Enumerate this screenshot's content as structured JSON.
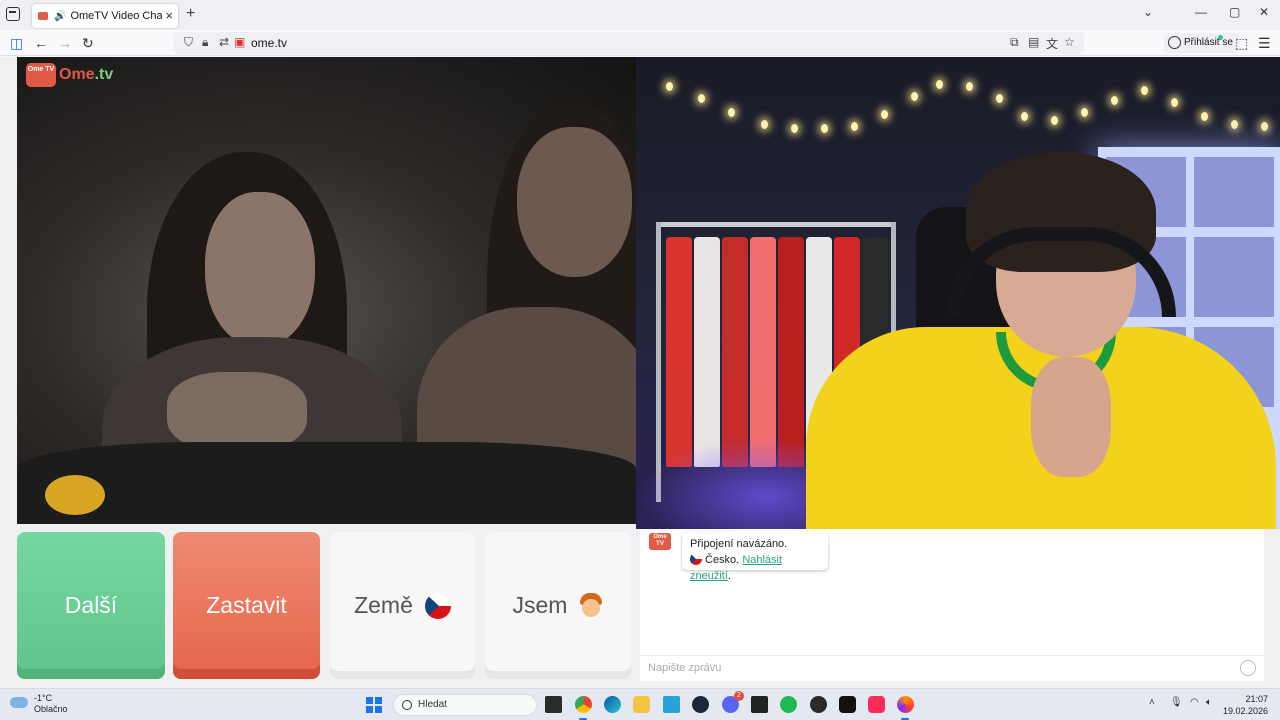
{
  "browser": {
    "tab": {
      "title": "OmeTV Video Chat — Ome",
      "new_tab": "+"
    },
    "window_controls": {
      "chevron": "⌄",
      "minimize": "—",
      "maximize": "▢",
      "close": "✕"
    },
    "url": "ome.tv",
    "signin_label": "Přihlásit se"
  },
  "video": {
    "logo_tv": "Ome TV",
    "logo_brand_left": "Ome",
    "logo_brand_right": ".tv"
  },
  "controls": {
    "next_label": "Další",
    "stop_label": "Zastavit",
    "country_label": "Země",
    "gender_label": "Jsem"
  },
  "chat": {
    "avatar_text": "Ome TV",
    "status_line": "Připojení navázáno.",
    "country_name": "Česko.",
    "report_link": "Nahlásit zneužití",
    "report_suffix": ".",
    "input_placeholder": "Napište zprávu"
  },
  "taskbar": {
    "weather_temp": "-1°C",
    "weather_desc": "Oblačno",
    "search_placeholder": "Hledat",
    "time": "21:07",
    "date": "19.02.2026",
    "discord_badge": "2"
  },
  "colors": {
    "accent_green": "#5fc58a",
    "accent_red": "#e5654a",
    "link": "#2aa084"
  }
}
